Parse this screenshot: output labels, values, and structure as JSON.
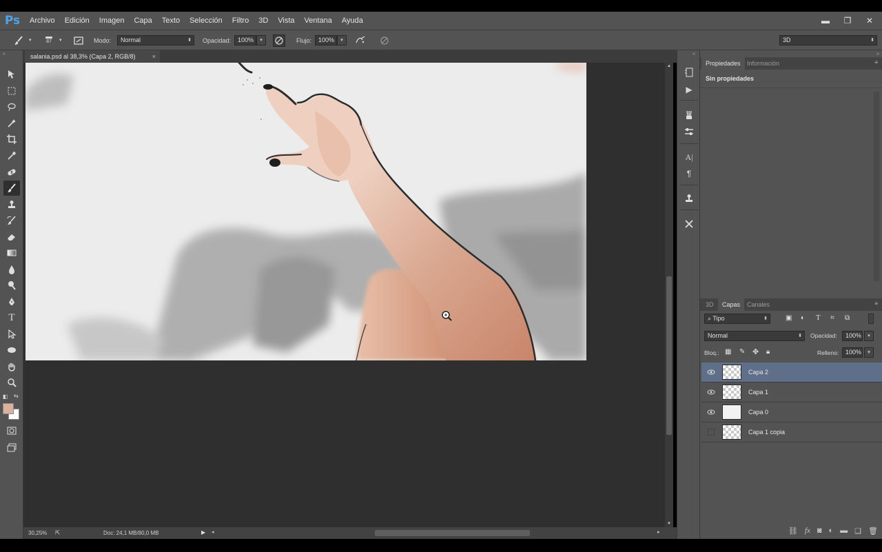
{
  "app": {
    "logo": "Ps"
  },
  "menu": [
    "Archivo",
    "Edición",
    "Imagen",
    "Capa",
    "Texto",
    "Selección",
    "Filtro",
    "3D",
    "Vista",
    "Ventana",
    "Ayuda"
  ],
  "window_controls": {
    "minimize": "▬",
    "restore": "❐",
    "close": "✕"
  },
  "options": {
    "brush_size": "87",
    "mode_label": "Modo:",
    "mode_value": "Normal",
    "opacity_label": "Opacidad:",
    "opacity_value": "100%",
    "flow_label": "Flujo:",
    "flow_value": "100%",
    "workspace_value": "3D"
  },
  "document": {
    "tab_title": "salania.psd al 38,3% (Capa 2, RGB/8)",
    "close": "×",
    "zoom": "30,25%",
    "doc_info": "Doc: 24,1 MB/80,0 MB"
  },
  "properties_panel": {
    "tabs": [
      "Propiedades",
      "Información"
    ],
    "content": "Sin propiedades"
  },
  "layers_panel": {
    "tabs": [
      "3D",
      "Capas",
      "Canales"
    ],
    "filter_label": "Tipo",
    "blend_mode": "Normal",
    "opacity_label": "Opacidad:",
    "opacity_value": "100%",
    "lock_label": "Bloq.:",
    "fill_label": "Relleno:",
    "fill_value": "100%",
    "layers": [
      {
        "name": "Capa 2",
        "visible": true,
        "selected": true,
        "thumb": "transparent"
      },
      {
        "name": "Capa 1",
        "visible": true,
        "selected": false,
        "thumb": "transparent"
      },
      {
        "name": "Capa 0",
        "visible": true,
        "selected": false,
        "thumb": "white"
      },
      {
        "name": "Capa 1 copia",
        "visible": false,
        "selected": false,
        "thumb": "transparent"
      }
    ]
  },
  "colors": {
    "foreground": "#d9b19c",
    "background": "#ffffff",
    "selection": "#5f6f89",
    "accent": "#4fa3e8"
  }
}
